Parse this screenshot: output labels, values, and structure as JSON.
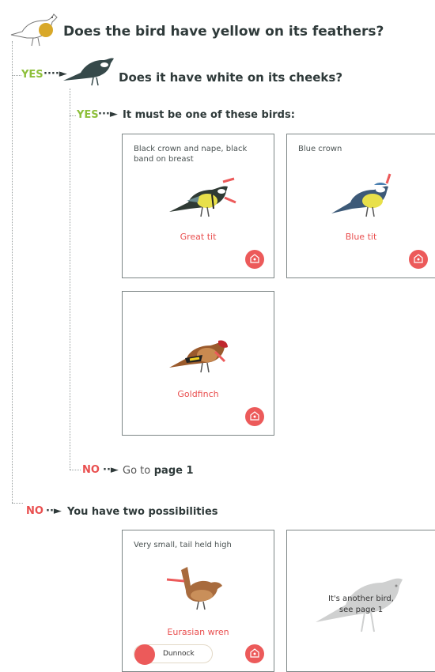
{
  "question_1": "Does the bird have yellow on its feathers?",
  "yes_label": "YES",
  "no_label": "NO",
  "question_2": "Does it have white on its cheeks?",
  "result_text": "It must be one of these birds:",
  "birds": [
    {
      "description": "Black crown and nape, black band on breast",
      "name": "Great tit"
    },
    {
      "description": "Blue crown",
      "name": "Blue tit"
    },
    {
      "description": "",
      "name": "Goldfinch"
    }
  ],
  "no_goto_prefix": "Go to",
  "no_goto_page": "page 1",
  "two_possibilities": "You have two possibilities",
  "possibilities": [
    {
      "description": "Very small, tail held high",
      "name": "Eurasian wren",
      "pill_label": "Dunnock"
    },
    {
      "other_text": "It's another bird,",
      "other_subtext": "see page 1"
    }
  ],
  "colors": {
    "yes": "#8dbf3a",
    "no": "#e94f4f",
    "accent": "#ec5a5a",
    "text": "#2f3a3a"
  }
}
